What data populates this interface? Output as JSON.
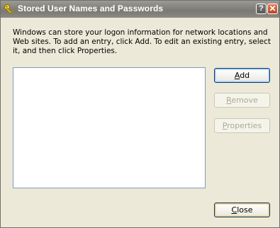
{
  "window": {
    "title": "Stored User Names and Passwords",
    "help_glyph": "?",
    "close_glyph": "✕",
    "title_icon": "key-icon"
  },
  "description": "Windows can store your logon information for network locations and Web sites. To add an entry, click Add. To edit an existing entry, select it, and then click Properties.",
  "credentials_list": {
    "items": []
  },
  "buttons": {
    "add": "Add",
    "remove": "Remove",
    "properties": "Properties",
    "close": "Close"
  },
  "colors": {
    "titlebar": "#84847c",
    "dialog_bg": "#ece9d8",
    "button_border": "#003c74",
    "disabled_text": "#aca899",
    "close_button_red": "#c0431e"
  }
}
